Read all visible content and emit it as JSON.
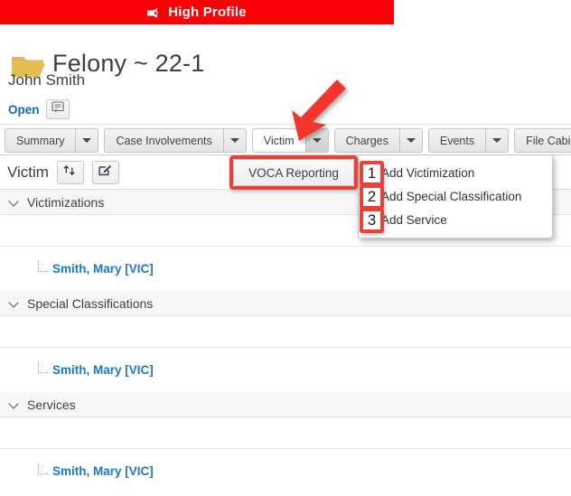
{
  "banner": {
    "label": "High Profile",
    "icon": "bullhorn-icon",
    "bg_color": "#fb0007",
    "text_color": "#ffffff"
  },
  "case_header": {
    "folder_icon": "folder-icon",
    "title": "Felony ~ 22-1",
    "person": "John Smith",
    "status_link": "Open",
    "note_icon": "comment-note-icon"
  },
  "tabs": [
    {
      "label": "Summary",
      "active": false
    },
    {
      "label": "Case Involvements",
      "active": false
    },
    {
      "label": "Victim",
      "active": true
    },
    {
      "label": "Charges",
      "active": false
    },
    {
      "label": "Events",
      "active": false
    },
    {
      "label": "File Cabinet",
      "active": false
    }
  ],
  "toolbar": {
    "title": "Victim",
    "swap_icon": "swap-arrows-icon",
    "edit_icon": "edit-pencil-square-icon"
  },
  "sections": [
    {
      "title": "Victimizations",
      "person": "Smith, Mary [VIC]"
    },
    {
      "title": "Special Classifications",
      "person": "Smith, Mary [VIC]"
    },
    {
      "title": "Services",
      "person": "Smith, Mary [VIC]"
    }
  ],
  "dropdown": {
    "voca_button": "VOCA Reporting",
    "items": [
      {
        "badge": "1",
        "label": "Add Victimization"
      },
      {
        "badge": "2",
        "label": "Add Special Classification"
      },
      {
        "badge": "3",
        "label": "Add Service"
      }
    ]
  },
  "annotations": {
    "highlight_color": "#e8423a",
    "arrow_color": "#f4352f",
    "arrow_points_to": "victim-tab-caret"
  }
}
